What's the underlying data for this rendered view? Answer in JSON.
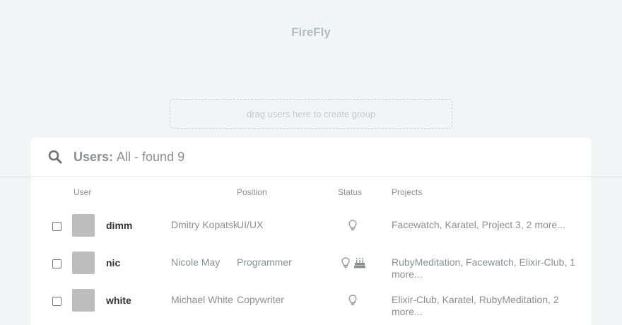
{
  "app": {
    "title": "FireFly"
  },
  "dropzone": {
    "text": "drag users here to create group"
  },
  "search": {
    "label": "Users:",
    "filter": "All - found 9"
  },
  "columns": {
    "user": "User",
    "position": "Position",
    "status": "Status",
    "projects": "Projects"
  },
  "users": [
    {
      "login": "dimm",
      "name": "Dmitry Kopatsky",
      "position": "UI/UX",
      "status_icons": [
        "bulb-icon"
      ],
      "projects": "Facewatch, Karatel, Project 3, 2 more..."
    },
    {
      "login": "nic",
      "name": "Nicole May",
      "position": "Programmer",
      "status_icons": [
        "bulb-icon",
        "cake-icon"
      ],
      "projects": "RubyMeditation, Facewatch, Elixir-Club, 1 more..."
    },
    {
      "login": "white",
      "name": "Michael White",
      "position": "Copywriter",
      "status_icons": [
        "bulb-icon"
      ],
      "projects": "Elixir-Club, Karatel, RubyMeditation, 2 more..."
    }
  ]
}
